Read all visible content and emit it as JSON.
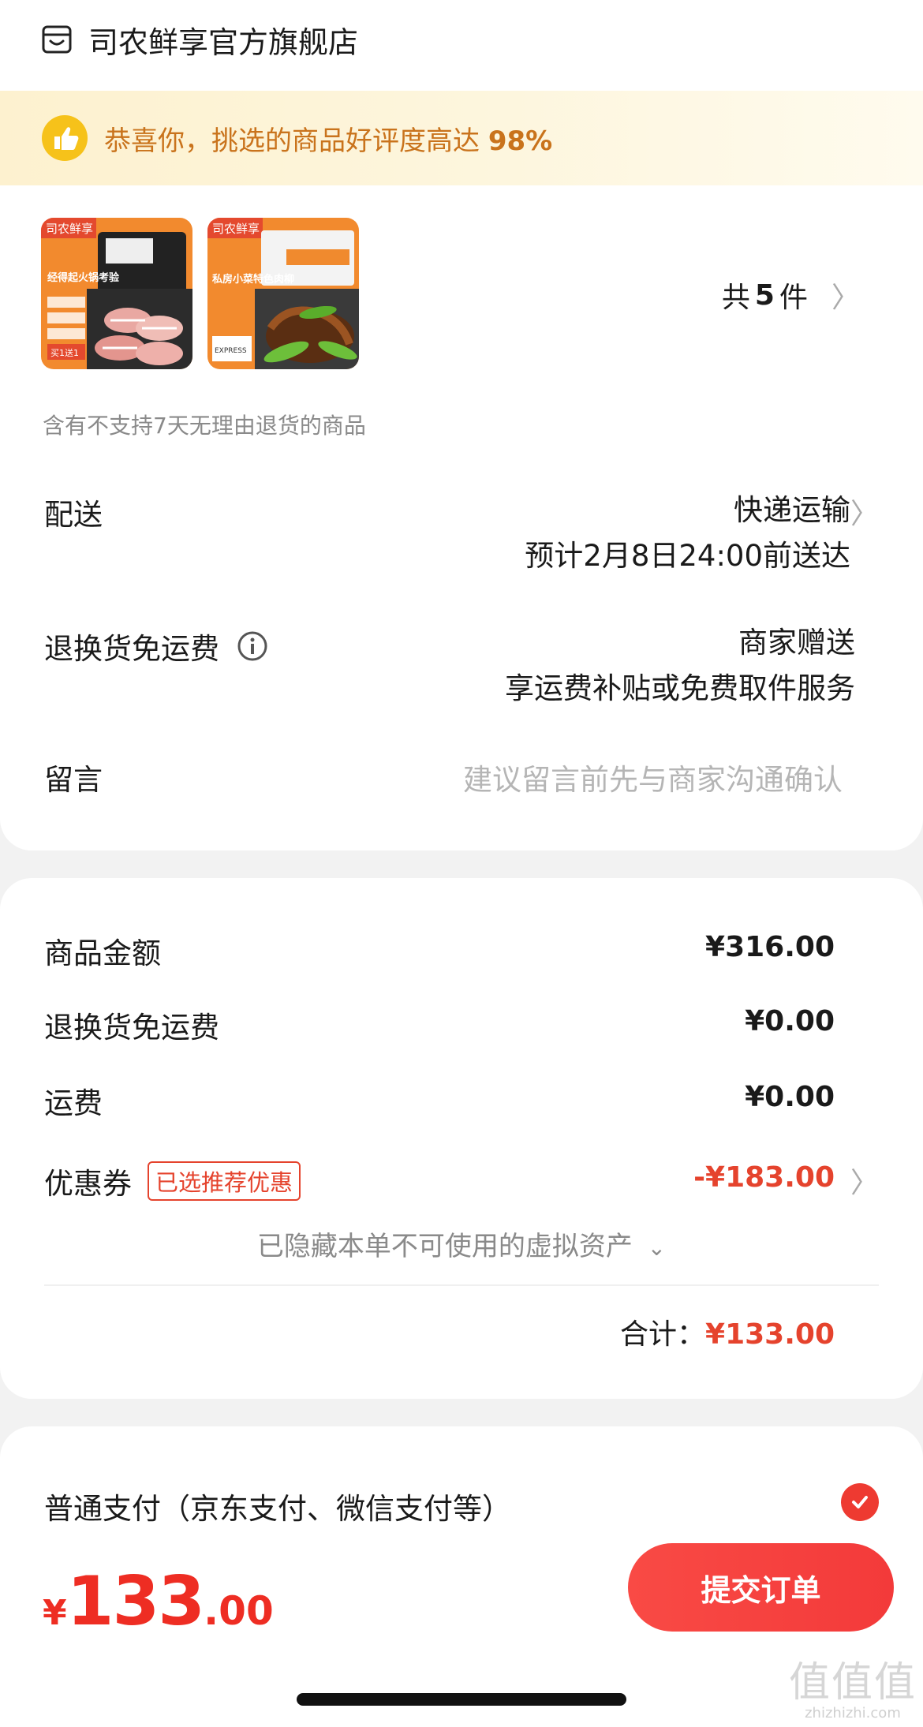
{
  "shop": {
    "name": "司农鲜享官方旗舰店"
  },
  "banner": {
    "text": "恭喜你，挑选的商品好评度高达",
    "percent": "98%"
  },
  "products": {
    "thumb1": {
      "brand": "司农鲜享",
      "tag": "经得起火锅考验",
      "tag2": "买1送1",
      "icon": "product-beef-rolls-image"
    },
    "thumb2": {
      "brand": "司农鲜享",
      "tag": "私房小菜特色肉柳",
      "tag2": "EXPRESS",
      "icon": "product-pork-strips-image"
    },
    "count_prefix": "共",
    "count": "5",
    "count_suffix": "件"
  },
  "return_note": "含有不支持7天无理由退货的商品",
  "delivery": {
    "label": "配送",
    "method": "快递运输",
    "eta": "预计2月8日24:00前送达"
  },
  "return_shipping": {
    "label": "退换货免运费",
    "line1": "商家赠送",
    "line2": "享运费补贴或免费取件服务"
  },
  "message": {
    "label": "留言",
    "placeholder": "建议留言前先与商家沟通确认"
  },
  "price": {
    "goods_label": "商品金额",
    "goods_value": "¥316.00",
    "returnfee_label": "退换货免运费",
    "returnfee_value": "¥0.00",
    "ship_label": "运费",
    "ship_value": "¥0.00",
    "coupon_label": "优惠券",
    "coupon_badge": "已选推荐优惠",
    "coupon_value": "-¥183.00",
    "hidden_assets": "已隐藏本单不可使用的虚拟资产",
    "total_label": "合计：",
    "total_value": "¥133.00"
  },
  "payment": {
    "method": "普通支付（京东支付、微信支付等）"
  },
  "bottom": {
    "symbol": "¥",
    "integer": "133",
    "decimal": ".00",
    "submit": "提交订单"
  },
  "watermark": {
    "big": "值值值",
    "small": "zhizhizhi.com"
  },
  "colors": {
    "accent": "#ee2d23",
    "banner_text": "#c9731c",
    "banner_bg": "#fdf1cf"
  }
}
